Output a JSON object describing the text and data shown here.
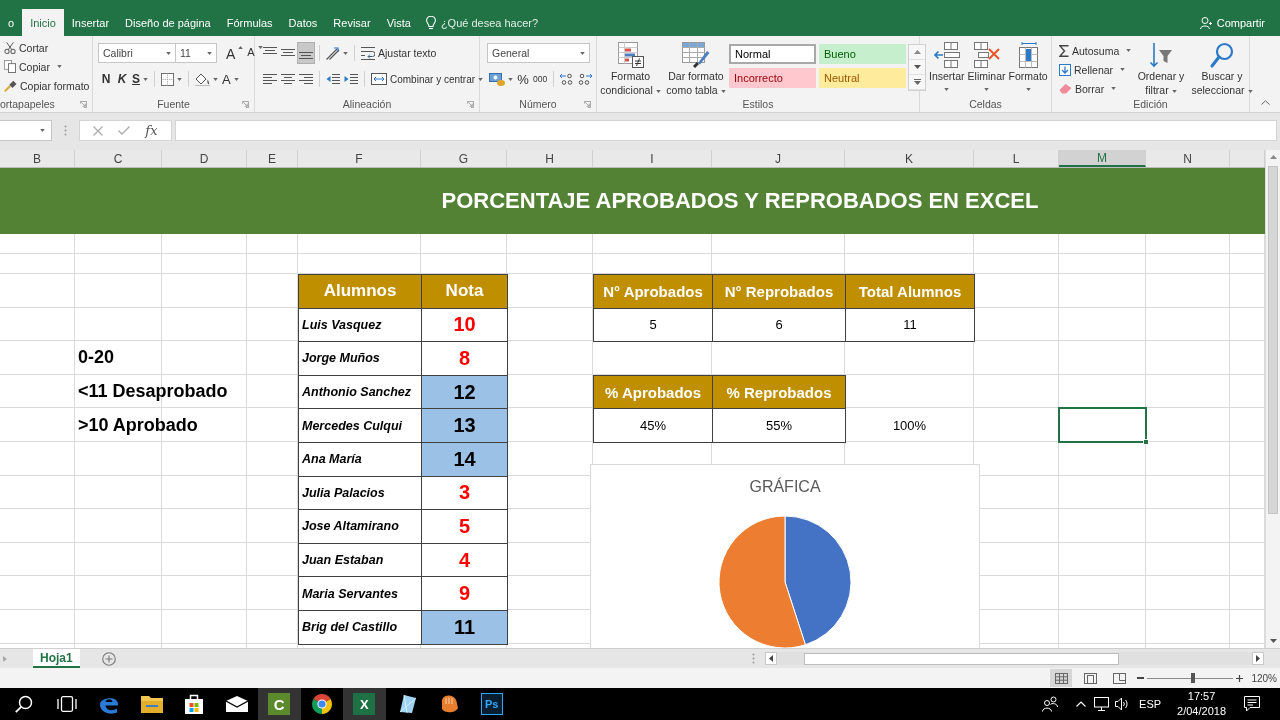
{
  "ribbon_tabs": [
    {
      "label": "o",
      "selected": false
    },
    {
      "label": "Inicio",
      "selected": true
    },
    {
      "label": "Insertar",
      "selected": false
    },
    {
      "label": "Diseño de página",
      "selected": false
    },
    {
      "label": "Fórmulas",
      "selected": false
    },
    {
      "label": "Datos",
      "selected": false
    },
    {
      "label": "Revisar",
      "selected": false
    },
    {
      "label": "Vista",
      "selected": false
    }
  ],
  "tell_me": {
    "placeholder": "¿Qué desea hacer?"
  },
  "share_button": "Compartir",
  "ribbon": {
    "clipboard": {
      "label": "ortapapeles",
      "commands": [
        {
          "label": "Cortar",
          "kind": "cut",
          "dropdown": false
        },
        {
          "label": "Copiar",
          "kind": "copy",
          "dropdown": true
        },
        {
          "label": "Copiar formato",
          "kind": "painter",
          "dropdown": false
        }
      ]
    },
    "font": {
      "label": "Fuente",
      "font_name": "Calibri",
      "font_size": "11",
      "grow": "A",
      "shrink": "A",
      "bold": "N",
      "italic": "K",
      "underline": "S",
      "font_color": "A"
    },
    "alignment": {
      "label": "Alineación",
      "vertical": [
        {
          "kind": "top",
          "on": false
        },
        {
          "kind": "middle",
          "on": false
        },
        {
          "kind": "bottom",
          "on": true
        }
      ],
      "horizontal": [
        {
          "kind": "left",
          "on": false
        },
        {
          "kind": "center",
          "on": false
        },
        {
          "kind": "right",
          "on": false
        }
      ],
      "wrap_text": "Ajustar texto",
      "merge": "Combinar y centrar"
    },
    "number": {
      "label": "Número",
      "format": "General",
      "percent": "%",
      "thousands": "000"
    },
    "styles": {
      "label": "Estilos",
      "conditional": "Formato condicional",
      "as_table": "Dar formato como tabla",
      "gallery": [
        {
          "label": "Normal",
          "kind": "normal",
          "selected": true
        },
        {
          "label": "Bueno",
          "kind": "good",
          "selected": false
        },
        {
          "label": "Incorrecto",
          "kind": "bad",
          "selected": false
        },
        {
          "label": "Neutral",
          "kind": "neutral",
          "selected": false
        }
      ]
    },
    "cells": {
      "label": "Celdas",
      "commands": [
        {
          "label": "Insertar",
          "kind": "insert"
        },
        {
          "label": "Eliminar",
          "kind": "delete"
        },
        {
          "label": "Formato",
          "kind": "format"
        }
      ]
    },
    "editing": {
      "label": "Edición",
      "commands": [
        {
          "label": "Autosuma",
          "kind": "sum"
        },
        {
          "label": "Rellenar",
          "kind": "fill"
        },
        {
          "label": "Borrar",
          "kind": "clear"
        }
      ],
      "large": [
        {
          "label": "Ordenar y filtrar",
          "kind": "sort"
        },
        {
          "label": "Buscar y seleccionar",
          "kind": "find"
        }
      ]
    }
  },
  "formula_bar": {
    "function_label": "fx"
  },
  "sheet": {
    "columns": [
      {
        "label": "B",
        "selected": false
      },
      {
        "label": "C",
        "selected": false
      },
      {
        "label": "D",
        "selected": false
      },
      {
        "label": "E",
        "selected": false
      },
      {
        "label": "F",
        "selected": false
      },
      {
        "label": "G",
        "selected": false
      },
      {
        "label": "H",
        "selected": false
      },
      {
        "label": "I",
        "selected": false
      },
      {
        "label": "J",
        "selected": false
      },
      {
        "label": "K",
        "selected": false
      },
      {
        "label": "L",
        "selected": false
      },
      {
        "label": "M",
        "selected": true
      },
      {
        "label": "N",
        "selected": false
      }
    ],
    "banner": "PORCENTAJE APROBADOS Y REPROBADOS EN EXCEL",
    "notes": [
      "0-20",
      "<11 Desaprobado",
      ">10 Aprobado"
    ],
    "grades": {
      "headers": [
        "Alumnos",
        "Nota"
      ],
      "rows": [
        {
          "name": "Luis Vasquez",
          "grade": "10",
          "passed": false
        },
        {
          "name": "Jorge Muños",
          "grade": "8",
          "passed": false
        },
        {
          "name": "Anthonio Sanchez",
          "grade": "12",
          "passed": true
        },
        {
          "name": "Mercedes Culqui",
          "grade": "13",
          "passed": true
        },
        {
          "name": "Ana María",
          "grade": "14",
          "passed": true
        },
        {
          "name": "Julia Palacios",
          "grade": "3",
          "passed": false
        },
        {
          "name": "Jose Altamirano",
          "grade": "5",
          "passed": false
        },
        {
          "name": "Juan Estaban",
          "grade": "4",
          "passed": false
        },
        {
          "name": "Maria Servantes",
          "grade": "9",
          "passed": false
        },
        {
          "name": "Brig del Castillo",
          "grade": "11",
          "passed": true
        }
      ]
    },
    "counts": {
      "headers": [
        "N° Aprobados",
        "N° Reprobados",
        "Total Alumnos"
      ],
      "values": [
        "5",
        "6",
        "11"
      ]
    },
    "percentages": {
      "headers": [
        "% Aprobados",
        "% Reprobados"
      ],
      "values": [
        "45%",
        "55%"
      ],
      "total": "100%"
    },
    "chart": {
      "chart_data": {
        "type": "pie",
        "title": "GRÁFICA",
        "values": [
          45,
          55
        ],
        "colors": [
          "#4472c4",
          "#ed7d31"
        ]
      }
    }
  },
  "sheet_tabs": [
    {
      "label": "Hoja1",
      "selected": true
    }
  ],
  "status_bar": {
    "views": [
      {
        "kind": "normal",
        "selected": true
      },
      {
        "kind": "page_layout",
        "selected": false
      },
      {
        "kind": "page_break",
        "selected": false
      }
    ],
    "zoom": {
      "level": 0.53,
      "reading": "120%"
    }
  },
  "taskbar": {
    "apps": [
      {
        "kind": "search",
        "active": false
      },
      {
        "kind": "task_view",
        "active": false
      },
      {
        "kind": "edge",
        "active": false
      },
      {
        "kind": "explorer",
        "active": false
      },
      {
        "kind": "store",
        "active": false
      },
      {
        "kind": "mail",
        "active": false
      },
      {
        "kind": "camtasia",
        "mark": "C",
        "active": true
      },
      {
        "kind": "chrome",
        "active": false
      },
      {
        "kind": "excel",
        "mark": "X",
        "active": true
      },
      {
        "kind": "crystal",
        "active": false
      },
      {
        "kind": "glove",
        "active": false
      },
      {
        "kind": "photoshop",
        "mark": "Ps",
        "active": false
      }
    ],
    "tray": {
      "language": "ESP",
      "time": "17:57",
      "date": "2/04/2018"
    }
  }
}
